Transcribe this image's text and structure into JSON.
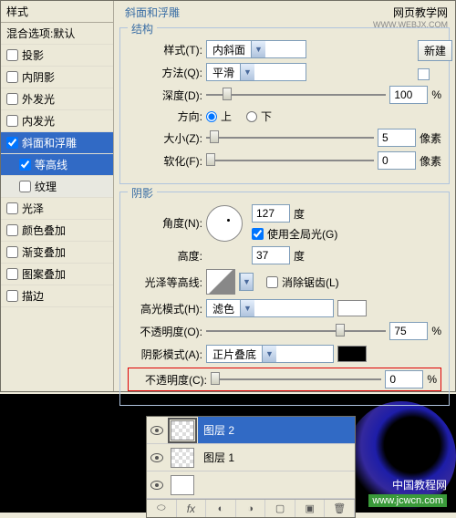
{
  "brand": {
    "name": "网页教学网",
    "url": "WWW.WEBJX.COM"
  },
  "sidebar": {
    "title": "样式",
    "blend": "混合选项:默认",
    "items": [
      {
        "label": "投影",
        "checked": false
      },
      {
        "label": "内阴影",
        "checked": false
      },
      {
        "label": "外发光",
        "checked": false
      },
      {
        "label": "内发光",
        "checked": false
      },
      {
        "label": "斜面和浮雕",
        "checked": true,
        "selected": true
      },
      {
        "label": "等高线",
        "checked": true,
        "indent": true,
        "selected": true
      },
      {
        "label": "纹理",
        "checked": false,
        "indent": true,
        "sel_light": true
      },
      {
        "label": "光泽",
        "checked": false
      },
      {
        "label": "颜色叠加",
        "checked": false
      },
      {
        "label": "渐变叠加",
        "checked": false
      },
      {
        "label": "图案叠加",
        "checked": false
      },
      {
        "label": "描边",
        "checked": false
      }
    ]
  },
  "panel_title": "斜面和浮雕",
  "structure": {
    "title": "结构",
    "style_label": "样式(T):",
    "style_value": "内斜面",
    "technique_label": "方法(Q):",
    "technique_value": "平滑",
    "depth_label": "深度(D):",
    "depth_value": "100",
    "depth_unit": "%",
    "direction_label": "方向:",
    "up": "上",
    "down": "下",
    "size_label": "大小(Z):",
    "size_value": "5",
    "size_unit": "像素",
    "soften_label": "软化(F):",
    "soften_value": "0",
    "soften_unit": "像素"
  },
  "shading": {
    "title": "阴影",
    "angle_label": "角度(N):",
    "angle_value": "127",
    "angle_unit": "度",
    "global_label": "使用全局光(G)",
    "altitude_label": "高度:",
    "altitude_value": "37",
    "altitude_unit": "度",
    "gloss_label": "光泽等高线:",
    "antialias_label": "消除锯齿(L)",
    "highlight_mode_label": "高光模式(H):",
    "highlight_mode_value": "滤色",
    "highlight_opacity_label": "不透明度(O):",
    "highlight_opacity_value": "75",
    "opacity_unit": "%",
    "shadow_mode_label": "阴影模式(A):",
    "shadow_mode_value": "正片叠底",
    "shadow_opacity_label": "不透明度(C):",
    "shadow_opacity_value": "0"
  },
  "right": {
    "new_btn": "新建"
  },
  "layers": {
    "items": [
      {
        "label": "图层 2",
        "selected": true
      },
      {
        "label": "图层 1",
        "selected": false
      }
    ]
  },
  "watermark": {
    "text": "中国教程网",
    "url": "www.jcwcn.com"
  }
}
